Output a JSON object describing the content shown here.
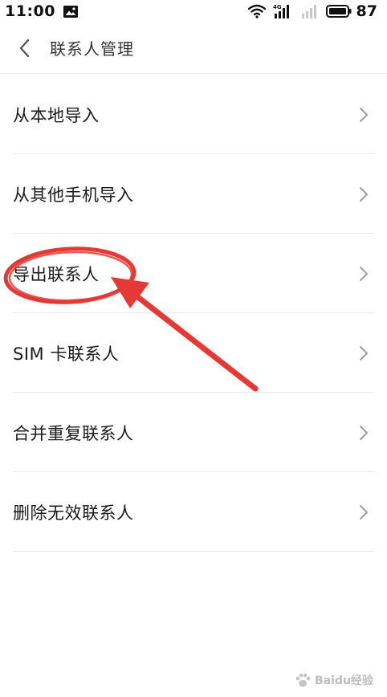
{
  "status_bar": {
    "time": "11:00",
    "network_label": "4G",
    "battery": "87",
    "icons": [
      "image-notification-icon",
      "wifi-icon",
      "signal-4g-icon",
      "signal-empty-icon",
      "battery-icon"
    ]
  },
  "header": {
    "back_icon": "chevron-left-icon",
    "title": "联系人管理"
  },
  "menu": {
    "items": [
      {
        "label": "从本地导入"
      },
      {
        "label": "从其他手机导入"
      },
      {
        "label": "导出联系人"
      },
      {
        "label": "SIM 卡联系人"
      },
      {
        "label": "合并重复联系人"
      },
      {
        "label": "删除无效联系人"
      }
    ],
    "chevron_icon": "chevron-right-icon"
  },
  "annotation": {
    "highlighted_item": "导出联系人",
    "color": "#e53935",
    "shape": "circle-with-arrow"
  },
  "watermark": {
    "text": "Baidu经验"
  },
  "colors": {
    "background": "#ffffff",
    "text_primary": "#1a1a1a",
    "divider": "#ebebeb",
    "chevron": "#9e9e9e",
    "annotation": "#e53935"
  }
}
